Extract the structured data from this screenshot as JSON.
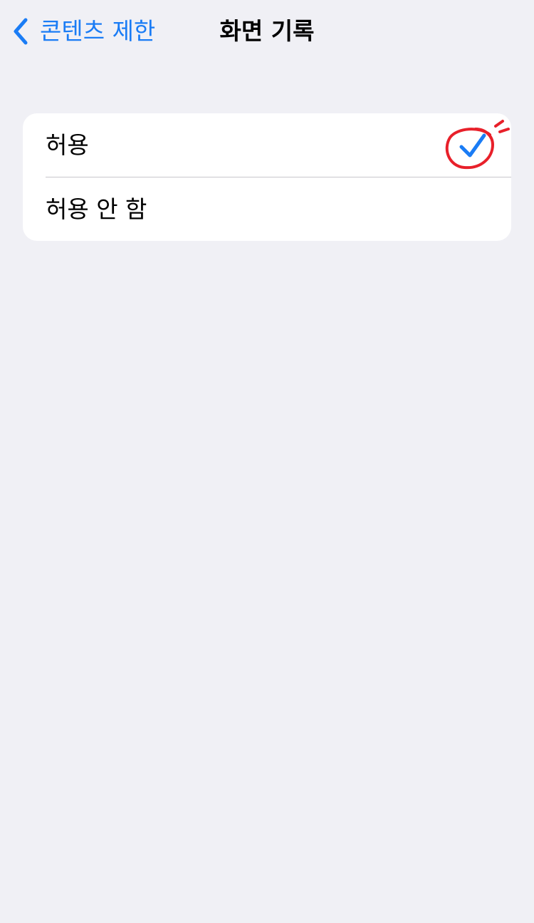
{
  "nav": {
    "back_label": "콘텐츠 제한",
    "title": "화면 기록"
  },
  "options": [
    {
      "label": "허용",
      "selected": true
    },
    {
      "label": "허용 안 함",
      "selected": false
    }
  ],
  "colors": {
    "background": "#F0F0F5",
    "accent": "#1A7CF5",
    "annotation": "#E8202A",
    "separator": "#C8C7CC"
  },
  "icons": {
    "back": "chevron-left-icon",
    "check": "checkmark-icon"
  }
}
